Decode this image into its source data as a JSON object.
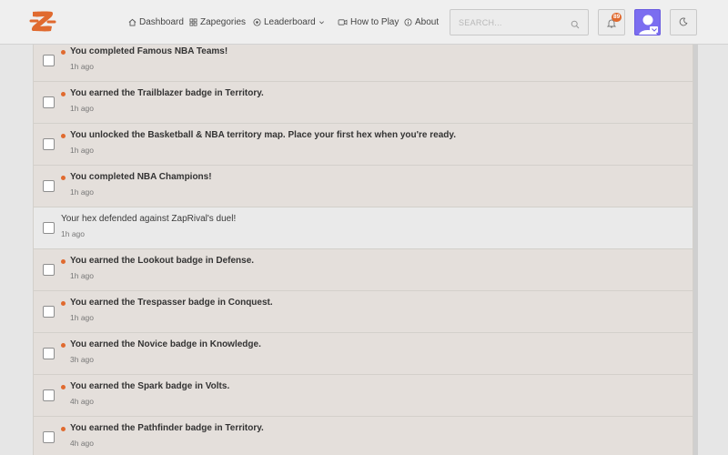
{
  "header": {
    "nav": [
      {
        "label": "Dashboard",
        "icon": "home-icon"
      },
      {
        "label": "Zapegories",
        "icon": "grid-icon"
      },
      {
        "label": "Leaderboard",
        "icon": "target-icon",
        "has_dropdown": true
      },
      {
        "label": "How to Play",
        "icon": "video-icon"
      },
      {
        "label": "About",
        "icon": "info-icon"
      }
    ],
    "search": {
      "placeholder": "SEARCH...",
      "value": ""
    },
    "notifications_count": "89"
  },
  "colors": {
    "accent": "#e06a2f",
    "avatar_bg": "#7b6df0",
    "unread_row": "#e4dfdb",
    "read_row": "#eaeaea"
  },
  "notifications": [
    {
      "message": "You completed Famous NBA Teams!",
      "time": "1h ago",
      "unread": true
    },
    {
      "message": "You earned the Trailblazer badge in Territory.",
      "time": "1h ago",
      "unread": true
    },
    {
      "message": "You unlocked the Basketball & NBA territory map. Place your first hex when you're ready.",
      "time": "1h ago",
      "unread": true
    },
    {
      "message": "You completed NBA Champions!",
      "time": "1h ago",
      "unread": true
    },
    {
      "message": "Your hex defended against ZapRival's duel!",
      "time": "1h ago",
      "unread": false
    },
    {
      "message": "You earned the Lookout badge in Defense.",
      "time": "1h ago",
      "unread": true
    },
    {
      "message": "You earned the Trespasser badge in Conquest.",
      "time": "1h ago",
      "unread": true
    },
    {
      "message": "You earned the Novice badge in Knowledge.",
      "time": "3h ago",
      "unread": true
    },
    {
      "message": "You earned the Spark badge in Volts.",
      "time": "4h ago",
      "unread": true
    },
    {
      "message": "You earned the Pathfinder badge in Territory.",
      "time": "4h ago",
      "unread": true
    }
  ]
}
